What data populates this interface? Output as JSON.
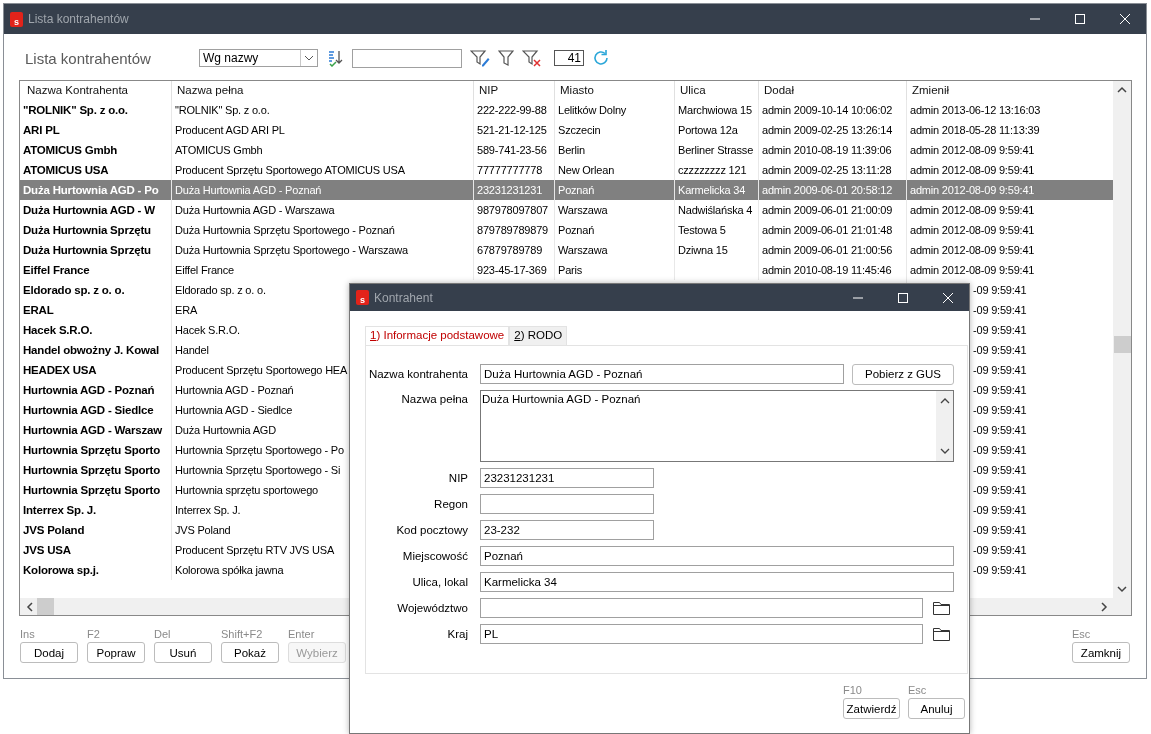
{
  "window": {
    "logo": "s",
    "title": "Lista kontrahentów"
  },
  "toolbar": {
    "heading": "Lista kontrahentów",
    "sort_select": "Wg nazwy",
    "count": "41"
  },
  "table": {
    "columns": [
      "Nazwa Kontrahenta",
      "Nazwa pełna",
      "NIP",
      "Miasto",
      "Ulica",
      "Dodał",
      "Zmienił"
    ],
    "rows": [
      {
        "nazwa": "\"ROLNIK\" Sp. z o.o.",
        "nazwa_pelna": "\"ROLNIK\" Sp. z o.o.",
        "nip": "222-222-99-88",
        "miasto": "Lelitków Dolny",
        "ulica": "Marchwiowa 15",
        "dodal": "admin 2009-10-14 10:06:02",
        "zmienil": "admin 2013-06-12 13:16:03",
        "selected": false
      },
      {
        "nazwa": "ARI PL",
        "nazwa_pelna": "Producent AGD ARI PL",
        "nip": "521-21-12-125",
        "miasto": "Szczecin",
        "ulica": "Portowa 12a",
        "dodal": "admin 2009-02-25 13:26:14",
        "zmienil": "admin 2018-05-28 11:13:39",
        "selected": false
      },
      {
        "nazwa": "ATOMICUS Gmbh",
        "nazwa_pelna": "ATOMICUS Gmbh",
        "nip": "589-741-23-56",
        "miasto": "Berlin",
        "ulica": "Berliner Strasse",
        "dodal": "admin 2010-08-19 11:39:06",
        "zmienil": "admin 2012-08-09  9:59:41",
        "selected": false
      },
      {
        "nazwa": "ATOMICUS USA",
        "nazwa_pelna": "Producent Sprzętu Sportowego ATOMICUS USA",
        "nip": "77777777778",
        "miasto": "New Orlean",
        "ulica": "czzzzzzzz 121",
        "dodal": "admin 2009-02-25 13:11:28",
        "zmienil": "admin 2012-08-09  9:59:41",
        "selected": false
      },
      {
        "nazwa": "Duża Hurtownia AGD - Po",
        "nazwa_pelna": "Duża Hurtownia AGD - Poznań",
        "nip": "23231231231",
        "miasto": "Poznań",
        "ulica": "Karmelicka 34",
        "dodal": "admin 2009-06-01 20:58:12",
        "zmienil": "admin 2012-08-09  9:59:41",
        "selected": true
      },
      {
        "nazwa": "Duża Hurtownia AGD - W",
        "nazwa_pelna": "Duża Hurtownia AGD - Warszawa",
        "nip": "987978097807",
        "miasto": "Warszawa",
        "ulica": "Nadwiślańska 4",
        "dodal": "admin 2009-06-01 21:00:09",
        "zmienil": "admin 2012-08-09  9:59:41",
        "selected": false
      },
      {
        "nazwa": "Duża Hurtownia Sprzętu",
        "nazwa_pelna": "Duża Hurtownia Sprzętu Sportowego - Poznań",
        "nip": "879789789879",
        "miasto": "Poznań",
        "ulica": "Testowa 5",
        "dodal": "admin 2009-06-01 21:01:48",
        "zmienil": "admin 2012-08-09  9:59:41",
        "selected": false
      },
      {
        "nazwa": "Duża Hurtownia Sprzętu",
        "nazwa_pelna": "Duża Hurtownia Sprzętu Sportowego - Warszawa",
        "nip": "67879789789",
        "miasto": "Warszawa",
        "ulica": "Dziwna 15",
        "dodal": "admin 2009-06-01 21:00:56",
        "zmienil": "admin 2012-08-09  9:59:41",
        "selected": false
      },
      {
        "nazwa": "Eiffel France",
        "nazwa_pelna": "Eiffel France",
        "nip": "923-45-17-369",
        "miasto": "Paris",
        "dodal": "admin 2010-08-19 11:45:46",
        "zmienil": "admin 2012-08-09  9:59:41",
        "selected": false
      },
      {
        "nazwa": "Eldorado sp. z o. o.",
        "nazwa_pelna": "Eldorado sp. z o. o.",
        "zmienil": "-09  9:59:41",
        "selected": false
      },
      {
        "nazwa": "ERAL",
        "nazwa_pelna": "ERA",
        "zmienil": "-09  9:59:41",
        "selected": false
      },
      {
        "nazwa": "Hacek S.R.O.",
        "nazwa_pelna": "Hacek S.R.O.",
        "zmienil": "-09  9:59:41",
        "selected": false
      },
      {
        "nazwa": "Handel obwożny J. Kowal",
        "nazwa_pelna": "Handel",
        "zmienil": "-09  9:59:41",
        "selected": false
      },
      {
        "nazwa": "HEADEX USA",
        "nazwa_pelna": "Producent Sprzętu Sportowego HEA",
        "zmienil": "-09  9:59:41",
        "selected": false
      },
      {
        "nazwa": "Hurtownia AGD - Poznań",
        "nazwa_pelna": "Hurtownia AGD - Poznań",
        "zmienil": "-09  9:59:41",
        "selected": false
      },
      {
        "nazwa": "Hurtownia AGD - Siedlce",
        "nazwa_pelna": "Hurtownia AGD - Siedlce",
        "zmienil": "-09  9:59:41",
        "selected": false
      },
      {
        "nazwa": "Hurtownia AGD - Warszaw",
        "nazwa_pelna": "Duża Hurtownia AGD",
        "zmienil": "-09  9:59:41",
        "selected": false
      },
      {
        "nazwa": "Hurtownia Sprzętu Sporto",
        "nazwa_pelna": "Hurtownia Sprzętu Sportowego - Po",
        "zmienil": "-09  9:59:41",
        "selected": false
      },
      {
        "nazwa": "Hurtownia Sprzętu Sporto",
        "nazwa_pelna": "Hurtownia Sprzętu Sportowego - Si",
        "zmienil": "-09  9:59:41",
        "selected": false
      },
      {
        "nazwa": "Hurtownia Sprzętu Sporto",
        "nazwa_pelna": "Hurtownia sprzętu sportowego",
        "zmienil": "-09  9:59:41",
        "selected": false
      },
      {
        "nazwa": "Interrex Sp. J.",
        "nazwa_pelna": "Interrex Sp. J.",
        "zmienil": "-09  9:59:41",
        "selected": false
      },
      {
        "nazwa": "JVS Poland",
        "nazwa_pelna": "JVS Poland",
        "zmienil": "-09  9:59:41",
        "selected": false
      },
      {
        "nazwa": "JVS USA",
        "nazwa_pelna": "Producent Sprzętu RTV JVS USA",
        "zmienil": "-09  9:59:41",
        "selected": false
      },
      {
        "nazwa": "Kolorowa sp.j.",
        "nazwa_pelna": "Kolorowa spółka jawna",
        "zmienil": "-09  9:59:41",
        "selected": false
      }
    ]
  },
  "actions": [
    {
      "shortcut": "Ins",
      "label": "Dodaj",
      "disabled": false
    },
    {
      "shortcut": "F2",
      "label": "Popraw",
      "disabled": false
    },
    {
      "shortcut": "Del",
      "label": "Usuń",
      "disabled": false
    },
    {
      "shortcut": "Shift+F2",
      "label": "Pokaż",
      "disabled": false
    },
    {
      "shortcut": "Enter",
      "label": "Wybierz",
      "disabled": true
    }
  ],
  "close_action": {
    "shortcut": "Esc",
    "label": "Zamknij"
  },
  "dialog": {
    "logo": "s",
    "title": "Kontrahent",
    "tabs": [
      {
        "label": "1) Informacje podstawowe",
        "selected": true
      },
      {
        "label": "2) RODO",
        "selected": false
      }
    ],
    "fields": [
      {
        "kind": "wide",
        "label": "Nazwa kontrahenta",
        "value": "Duża Hurtownia AGD - Poznań",
        "button": "Pobierz z GUS"
      },
      {
        "kind": "textarea",
        "label": "Nazwa pełna",
        "value": "Duża Hurtownia AGD - Poznań"
      },
      {
        "kind": "short",
        "label": "NIP",
        "value": "23231231231"
      },
      {
        "kind": "short",
        "label": "Regon"
      },
      {
        "kind": "short",
        "label": "Kod pocztowy",
        "value": "23-232"
      },
      {
        "kind": "full",
        "label": "Miejscowość",
        "value": "Poznań"
      },
      {
        "kind": "full",
        "label": "Ulica, lokal",
        "value": "Karmelicka 34"
      },
      {
        "kind": "picker",
        "label": "Województwo"
      },
      {
        "kind": "picker",
        "label": "Kraj",
        "value": "PL"
      }
    ],
    "buttons": [
      {
        "shortcut": "F10",
        "label": "Zatwierdź"
      },
      {
        "shortcut": "Esc",
        "label": "Anuluj"
      }
    ]
  }
}
